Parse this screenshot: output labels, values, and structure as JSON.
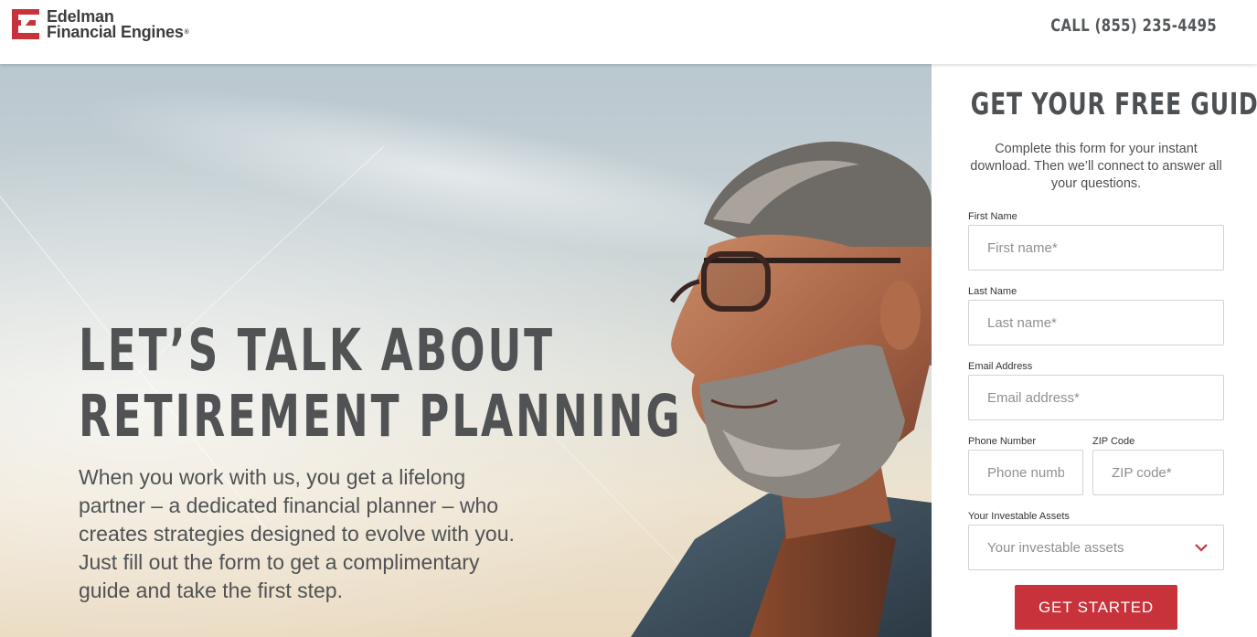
{
  "header": {
    "logo_line1": "Edelman",
    "logo_line2": "Financial Engines",
    "logo_reg": "®",
    "call_text": "CALL (855) 235-4495"
  },
  "hero": {
    "title_line1": "LET’S TALK ABOUT",
    "title_line2": "RETIREMENT PLANNING",
    "body": "When you work with us, you get a lifelong partner – a dedicated financial planner – who creates strategies designed to evolve with you. Just fill out the form to get a complimentary guide and take the first step."
  },
  "form": {
    "title": "GET YOUR FREE GUIDE",
    "description": "Complete this form for your instant download. Then we’ll connect to answer all your questions.",
    "first_name": {
      "label": "First Name",
      "placeholder": "First name*",
      "value": ""
    },
    "last_name": {
      "label": "Last Name",
      "placeholder": "Last name*",
      "value": ""
    },
    "email": {
      "label": "Email Address",
      "placeholder": "Email address*",
      "value": ""
    },
    "phone": {
      "label": "Phone Number",
      "placeholder": "Phone number*",
      "value": ""
    },
    "zip": {
      "label": "ZIP Code",
      "placeholder": "ZIP code*",
      "value": ""
    },
    "assets": {
      "label": "Your Investable Assets",
      "selected": "Your investable assets"
    },
    "submit_label": "GET STARTED"
  },
  "colors": {
    "brand_red": "#c8333b",
    "text_gray": "#505254"
  },
  "icons": {
    "logo": "edelman-logo-icon",
    "chevron": "chevron-down-icon"
  }
}
